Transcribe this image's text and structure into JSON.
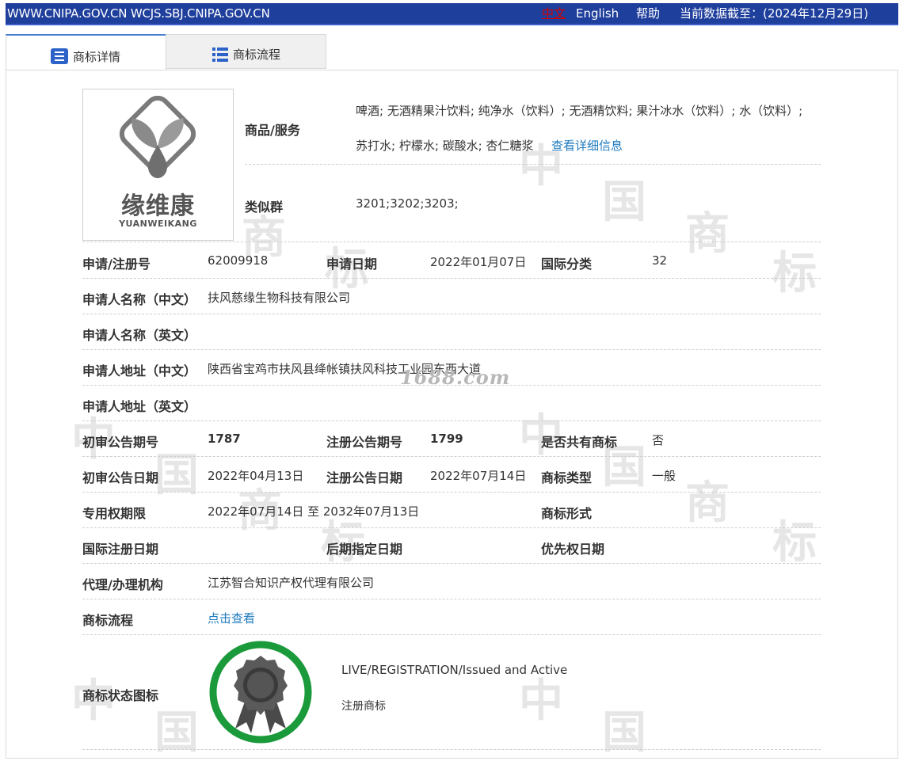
{
  "topbar": {
    "site": "WWW.CNIPA.GOV.CN WCJS.SBJ.CNIPA.GOV.CN",
    "lang_zh": "中文",
    "lang_en": "English",
    "help": "帮助",
    "data_as_of": "当前数据截至：(2024年12月29日)"
  },
  "tabs": [
    {
      "label": "商标详情"
    },
    {
      "label": "商标流程"
    }
  ],
  "logo": {
    "brand_cn": "缘维康",
    "brand_en": "YUANWEIKANG"
  },
  "goods": {
    "label": "商品/服务",
    "line1": "啤酒; 无酒精果汁饮料; 纯净水（饮料）; 无酒精饮料; 果汁冰水（饮料）; 水（饮料）;",
    "line2": "苏打水; 柠檬水; 碳酸水; 杏仁糖浆",
    "detail_link": "查看详细信息"
  },
  "similar_group": {
    "label": "类似群",
    "value": "3201;3202;3203;"
  },
  "rows": {
    "reg_no_label": "申请/注册号",
    "reg_no": "62009918",
    "app_date_label": "申请日期",
    "app_date": "2022年01月07日",
    "intl_class_label": "国际分类",
    "intl_class": "32",
    "applicant_cn_label": "申请人名称（中文）",
    "applicant_cn": "扶风慈缘生物科技有限公司",
    "applicant_en_label": "申请人名称（英文）",
    "address_cn_label": "申请人地址（中文）",
    "address_cn": "陕西省宝鸡市扶风县绛帐镇扶风科技工业园东西大道",
    "address_en_label": "申请人地址（英文）",
    "prelim_issue_label": "初审公告期号",
    "prelim_issue": "1787",
    "reg_issue_label": "注册公告期号",
    "reg_issue": "1799",
    "shared_label": "是否共有商标",
    "shared": "否",
    "prelim_date_label": "初审公告日期",
    "prelim_date": "2022年04月13日",
    "reg_date_label": "注册公告日期",
    "reg_date": "2022年07月14日",
    "tm_type_label": "商标类型",
    "tm_type": "一般",
    "exclusive_label": "专用权期限",
    "exclusive": "2022年07月14日 至 2032年07月13日",
    "tm_form_label": "商标形式",
    "intl_reg_date_label": "国际注册日期",
    "later_designation_label": "后期指定日期",
    "priority_date_label": "优先权日期",
    "agent_label": "代理/办理机构",
    "agent": "江苏智合知识产权代理有限公司",
    "flow_label": "商标流程",
    "flow_link": "点击查看",
    "status_icon_label": "商标状态图标",
    "status_en": "LIVE/REGISTRATION/Issued and Active",
    "status_cn": "注册商标"
  },
  "watermark": {
    "site": "1688.com"
  },
  "colors": {
    "topbar": "#1f3f9c",
    "link": "#1f7bbf",
    "badge_ring": "#1a9a3a"
  }
}
